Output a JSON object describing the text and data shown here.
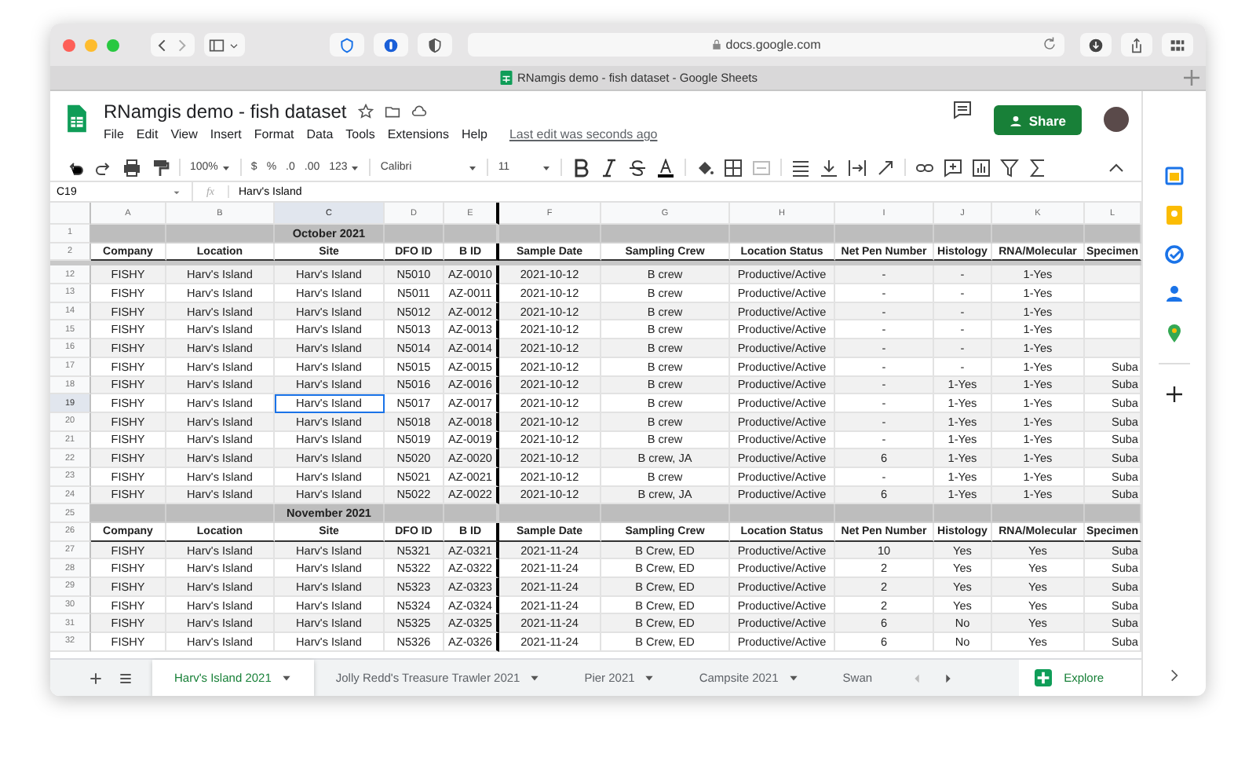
{
  "browser": {
    "url": "docs.google.com",
    "tab_title": "RNamgis demo - fish dataset - Google Sheets"
  },
  "doc": {
    "title": "RNamgis demo - fish dataset",
    "menu": [
      "File",
      "Edit",
      "View",
      "Insert",
      "Format",
      "Data",
      "Tools",
      "Extensions",
      "Help"
    ],
    "last_edit": "Last edit was seconds ago",
    "share": "Share"
  },
  "toolbar": {
    "zoom": "100%",
    "currency": "$",
    "percent": "%",
    "decrease_decimals": ".0",
    "increase_decimals": ".00",
    "number_format": "123",
    "font": "Calibri",
    "font_size": "11"
  },
  "formula_bar": {
    "cell": "C19",
    "fx": "fx",
    "value": "Harv's Island"
  },
  "columns": [
    {
      "letter": "A",
      "selected": false
    },
    {
      "letter": "B",
      "selected": false
    },
    {
      "letter": "C",
      "selected": true
    },
    {
      "letter": "D",
      "selected": false
    },
    {
      "letter": "E",
      "selected": false
    },
    {
      "letter": "F",
      "selected": false
    },
    {
      "letter": "G",
      "selected": false
    },
    {
      "letter": "H",
      "selected": false
    },
    {
      "letter": "I",
      "selected": false
    },
    {
      "letter": "J",
      "selected": false
    },
    {
      "letter": "K",
      "selected": false
    },
    {
      "letter": "L",
      "selected": false
    }
  ],
  "rows": [
    {
      "num": "1",
      "kind": "month",
      "selected": false,
      "label": "October 2021"
    },
    {
      "num": "2",
      "kind": "header",
      "selected": false,
      "cells": [
        "Company",
        "Location",
        "Site",
        "DFO ID",
        "B ID",
        "Sample Date",
        "Sampling Crew",
        "Location Status",
        "Net Pen Number",
        "Histology",
        "RNA/Molecular",
        "Specimen"
      ]
    },
    {
      "num": "12",
      "kind": "data",
      "selected": false,
      "cells": [
        "FISHY",
        "Harv's Island",
        "Harv's Island",
        "N5010",
        "AZ-0010",
        "2021-10-12",
        "B crew",
        "Productive/Active",
        "-",
        "-",
        "1-Yes"
      ]
    },
    {
      "num": "13",
      "kind": "data",
      "selected": false,
      "cells": [
        "FISHY",
        "Harv's Island",
        "Harv's Island",
        "N5011",
        "AZ-0011",
        "2021-10-12",
        "B crew",
        "Productive/Active",
        "-",
        "-",
        "1-Yes"
      ]
    },
    {
      "num": "14",
      "kind": "data",
      "selected": false,
      "cells": [
        "FISHY",
        "Harv's Island",
        "Harv's Island",
        "N5012",
        "AZ-0012",
        "2021-10-12",
        "B crew",
        "Productive/Active",
        "-",
        "-",
        "1-Yes"
      ]
    },
    {
      "num": "15",
      "kind": "data",
      "selected": false,
      "cells": [
        "FISHY",
        "Harv's Island",
        "Harv's Island",
        "N5013",
        "AZ-0013",
        "2021-10-12",
        "B crew",
        "Productive/Active",
        "-",
        "-",
        "1-Yes"
      ]
    },
    {
      "num": "16",
      "kind": "data",
      "selected": false,
      "cells": [
        "FISHY",
        "Harv's Island",
        "Harv's Island",
        "N5014",
        "AZ-0014",
        "2021-10-12",
        "B crew",
        "Productive/Active",
        "-",
        "-",
        "1-Yes"
      ]
    },
    {
      "num": "17",
      "kind": "data",
      "selected": false,
      "cells": [
        "FISHY",
        "Harv's Island",
        "Harv's Island",
        "N5015",
        "AZ-0015",
        "2021-10-12",
        "B crew",
        "Productive/Active",
        "-",
        "-",
        "1-Yes",
        "Suba"
      ]
    },
    {
      "num": "18",
      "kind": "data",
      "selected": false,
      "cells": [
        "FISHY",
        "Harv's Island",
        "Harv's Island",
        "N5016",
        "AZ-0016",
        "2021-10-12",
        "B crew",
        "Productive/Active",
        "-",
        "1-Yes",
        "1-Yes",
        "Suba"
      ]
    },
    {
      "num": "19",
      "kind": "data",
      "selected": true,
      "cells": [
        "FISHY",
        "Harv's Island",
        "Harv's Island",
        "N5017",
        "AZ-0017",
        "2021-10-12",
        "B crew",
        "Productive/Active",
        "-",
        "1-Yes",
        "1-Yes",
        "Suba"
      ]
    },
    {
      "num": "20",
      "kind": "data",
      "selected": false,
      "cells": [
        "FISHY",
        "Harv's Island",
        "Harv's Island",
        "N5018",
        "AZ-0018",
        "2021-10-12",
        "B crew",
        "Productive/Active",
        "-",
        "1-Yes",
        "1-Yes",
        "Suba"
      ]
    },
    {
      "num": "21",
      "kind": "data",
      "selected": false,
      "cells": [
        "FISHY",
        "Harv's Island",
        "Harv's Island",
        "N5019",
        "AZ-0019",
        "2021-10-12",
        "B crew",
        "Productive/Active",
        "-",
        "1-Yes",
        "1-Yes",
        "Suba"
      ]
    },
    {
      "num": "22",
      "kind": "data",
      "selected": false,
      "cells": [
        "FISHY",
        "Harv's Island",
        "Harv's Island",
        "N5020",
        "AZ-0020",
        "2021-10-12",
        "B crew, JA",
        "Productive/Active",
        "6",
        "1-Yes",
        "1-Yes",
        "Suba"
      ]
    },
    {
      "num": "23",
      "kind": "data",
      "selected": false,
      "cells": [
        "FISHY",
        "Harv's Island",
        "Harv's Island",
        "N5021",
        "AZ-0021",
        "2021-10-12",
        "B crew",
        "Productive/Active",
        "-",
        "1-Yes",
        "1-Yes",
        "Suba"
      ]
    },
    {
      "num": "24",
      "kind": "data",
      "selected": false,
      "cells": [
        "FISHY",
        "Harv's Island",
        "Harv's Island",
        "N5022",
        "AZ-0022",
        "2021-10-12",
        "B crew, JA",
        "Productive/Active",
        "6",
        "1-Yes",
        "1-Yes",
        "Suba"
      ]
    },
    {
      "num": "25",
      "kind": "month",
      "selected": false,
      "label": "November 2021"
    },
    {
      "num": "26",
      "kind": "header",
      "selected": false,
      "cells": [
        "Company",
        "Location",
        "Site",
        "DFO ID",
        "B ID",
        "Sample Date",
        "Sampling Crew",
        "Location Status",
        "Net Pen Number",
        "Histology",
        "RNA/Molecular",
        "Specimen"
      ]
    },
    {
      "num": "27",
      "kind": "data",
      "selected": false,
      "cells": [
        "FISHY",
        "Harv's Island",
        "Harv's Island",
        "N5321",
        "AZ-0321",
        "2021-11-24",
        "B Crew, ED",
        "Productive/Active",
        "10",
        "Yes",
        "Yes",
        "Suba"
      ]
    },
    {
      "num": "28",
      "kind": "data",
      "selected": false,
      "cells": [
        "FISHY",
        "Harv's Island",
        "Harv's Island",
        "N5322",
        "AZ-0322",
        "2021-11-24",
        "B Crew, ED",
        "Productive/Active",
        "2",
        "Yes",
        "Yes",
        "Suba"
      ]
    },
    {
      "num": "29",
      "kind": "data",
      "selected": false,
      "cells": [
        "FISHY",
        "Harv's Island",
        "Harv's Island",
        "N5323",
        "AZ-0323",
        "2021-11-24",
        "B Crew, ED",
        "Productive/Active",
        "2",
        "Yes",
        "Yes",
        "Suba"
      ]
    },
    {
      "num": "30",
      "kind": "data",
      "selected": false,
      "cells": [
        "FISHY",
        "Harv's Island",
        "Harv's Island",
        "N5324",
        "AZ-0324",
        "2021-11-24",
        "B Crew, ED",
        "Productive/Active",
        "2",
        "Yes",
        "Yes",
        "Suba"
      ]
    },
    {
      "num": "31",
      "kind": "data",
      "selected": false,
      "cells": [
        "FISHY",
        "Harv's Island",
        "Harv's Island",
        "N5325",
        "AZ-0325",
        "2021-11-24",
        "B Crew, ED",
        "Productive/Active",
        "6",
        "No",
        "Yes",
        "Suba"
      ]
    },
    {
      "num": "32",
      "kind": "data",
      "selected": false,
      "cells": [
        "FISHY",
        "Harv's Island",
        "Harv's Island",
        "N5326",
        "AZ-0326",
        "2021-11-24",
        "B Crew, ED",
        "Productive/Active",
        "6",
        "No",
        "Yes",
        "Suba"
      ]
    }
  ],
  "sheet_tabs": [
    {
      "label": "Harv's Island 2021",
      "selected": true
    },
    {
      "label": "Jolly Redd's Treasure Trawler 2021",
      "selected": false
    },
    {
      "label": "Pier 2021",
      "selected": false
    },
    {
      "label": "Campsite 2021",
      "selected": false
    },
    {
      "label": "Swan",
      "selected": false
    }
  ],
  "explore": "Explore"
}
